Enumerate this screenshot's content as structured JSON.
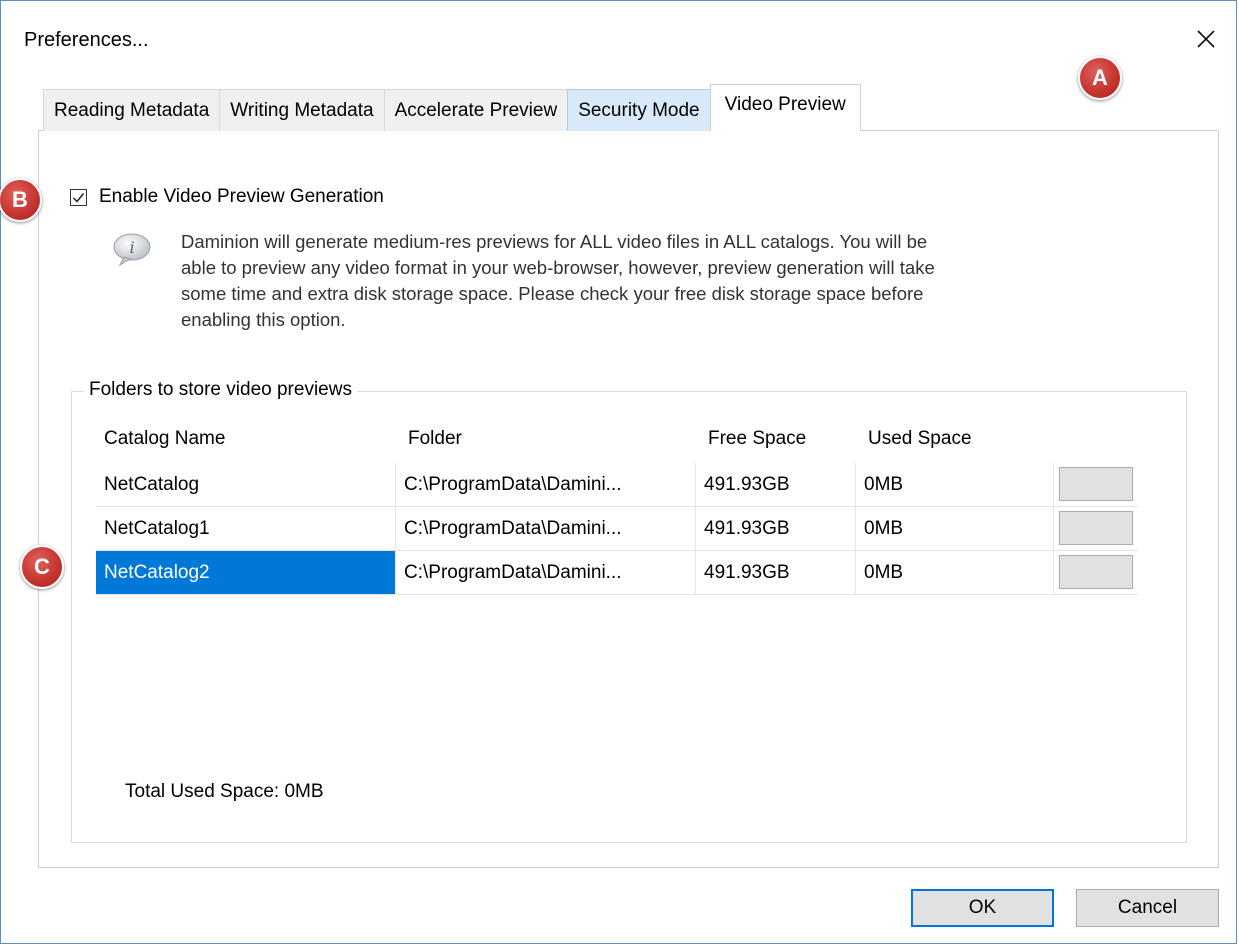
{
  "window": {
    "title": "Preferences..."
  },
  "tabs": [
    {
      "label": "Reading Metadata"
    },
    {
      "label": "Writing Metadata"
    },
    {
      "label": "Accelerate Preview"
    },
    {
      "label": "Security Mode"
    },
    {
      "label": "Video Preview"
    }
  ],
  "enable_checkbox": {
    "label": "Enable Video Preview Generation",
    "checked": true
  },
  "info": {
    "icon": "info-bubble-icon",
    "lines": [
      "Daminion will generate medium-res previews for ALL video files in ALL catalogs.  You will be",
      "able to preview any video format in your web-browser, however, preview generation will take",
      "some time and extra disk storage space.  Please check your free disk storage space before",
      "enabling this option."
    ]
  },
  "folders_group": {
    "legend": "Folders to store video previews",
    "columns": [
      "Catalog Name",
      "Folder",
      "Free Space",
      "Used Space"
    ],
    "rows": [
      {
        "catalog": "NetCatalog",
        "folder": "C:\\ProgramData\\Damini...",
        "free": "491.93GB",
        "used": "0MB"
      },
      {
        "catalog": "NetCatalog1",
        "folder": "C:\\ProgramData\\Damini...",
        "free": "491.93GB",
        "used": "0MB"
      },
      {
        "catalog": "NetCatalog2",
        "folder": "C:\\ProgramData\\Damini...",
        "free": "491.93GB",
        "used": "0MB"
      }
    ],
    "selected_row": 2,
    "total_label": "Total Used Space: 0MB"
  },
  "buttons": {
    "ok": "OK",
    "cancel": "Cancel"
  },
  "annotations": [
    "A",
    "B",
    "C"
  ],
  "colors": {
    "selection": "#0078d7",
    "badge": "#c5322e",
    "window_border": "#5b8fc7"
  }
}
